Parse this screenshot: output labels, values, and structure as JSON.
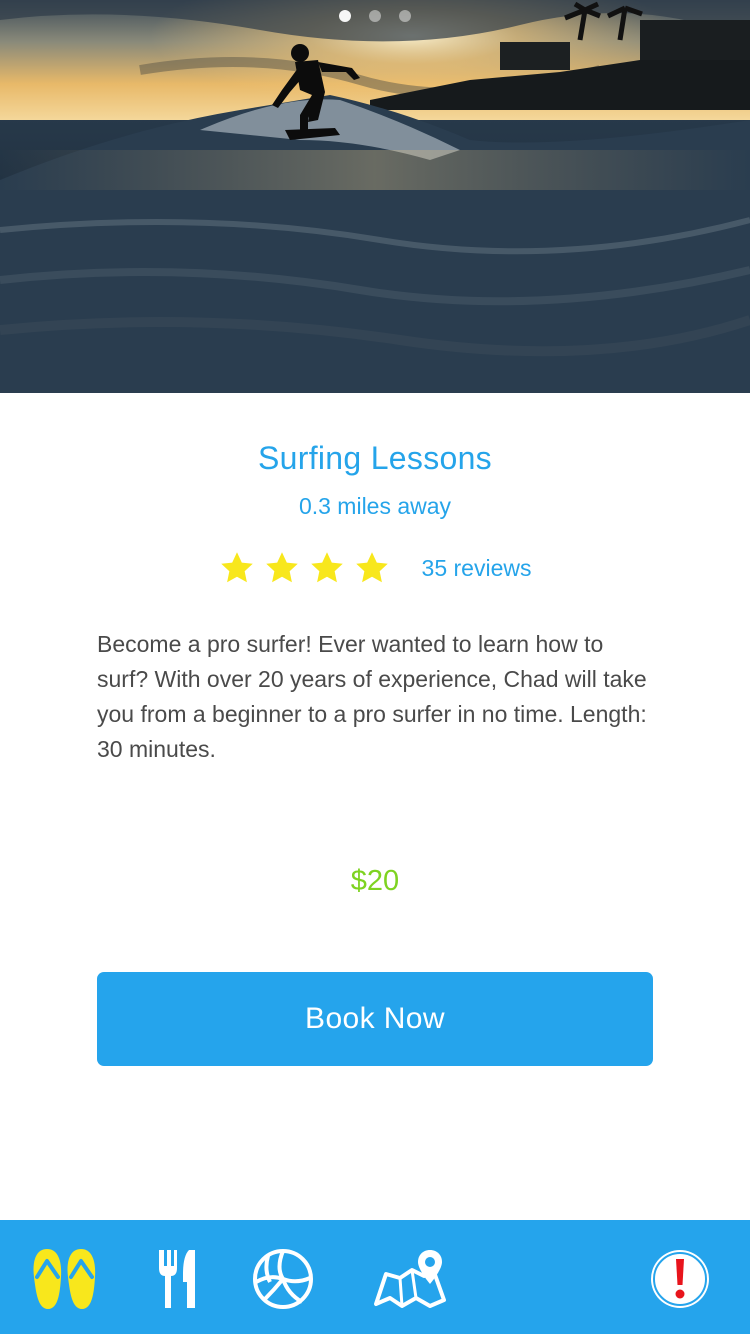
{
  "hero": {
    "slides": 3,
    "active_slide": 1,
    "image_subject": "surfer riding a wave at sunset"
  },
  "activity": {
    "title": "Surfing Lessons",
    "distance": "0.3 miles away",
    "rating_stars": 4,
    "reviews": "35 reviews",
    "description": "Become a pro surfer! Ever wanted to learn how to surf? With over 20 years of experience, Chad will take you from a beginner to a pro surfer in no time. Length: 30 minutes.",
    "price": "$20"
  },
  "actions": {
    "book_label": "Book Now"
  },
  "tabbar": {
    "items": [
      {
        "icon": "flip-flops-icon",
        "active": true
      },
      {
        "icon": "fork-knife-icon",
        "active": false
      },
      {
        "icon": "volleyball-icon",
        "active": false
      },
      {
        "icon": "map-pin-icon",
        "active": false
      },
      {
        "icon": "alert-icon",
        "active": false
      }
    ]
  },
  "colors": {
    "accent_blue": "#25a4ec",
    "price_green": "#7ed321",
    "star_yellow": "#f8e71c",
    "alert_red": "#e8141c",
    "text_gray": "#4a4a4a"
  }
}
